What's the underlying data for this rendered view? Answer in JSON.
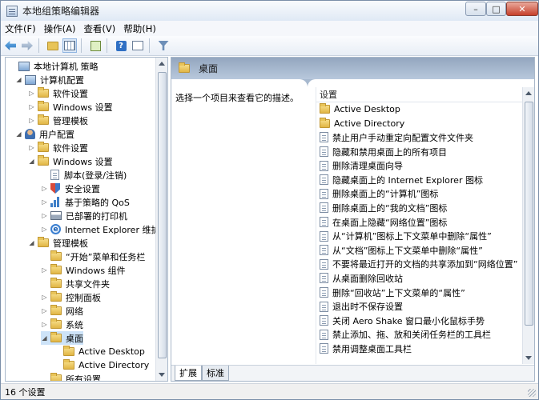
{
  "window": {
    "title": "本地组策略编辑器",
    "min": "–",
    "max": "□",
    "close": "✕"
  },
  "menu": [
    "文件(F)",
    "操作(A)",
    "查看(V)",
    "帮助(H)"
  ],
  "toolbar": {
    "icons": [
      "back-icon",
      "forward-icon",
      "up-folder-icon",
      "show-hide-tree-icon",
      "export-icon",
      "help-icon",
      "properties-icon",
      "filter-icon"
    ]
  },
  "tree": [
    {
      "label": "本地计算机 策略",
      "icon": "policy-icon",
      "level": 0,
      "exp": ""
    },
    {
      "label": "计算机配置",
      "icon": "computer-icon",
      "level": 1,
      "exp": "◢"
    },
    {
      "label": "软件设置",
      "icon": "folder-icon",
      "level": 2,
      "exp": "▷"
    },
    {
      "label": "Windows 设置",
      "icon": "folder-icon",
      "level": 2,
      "exp": "▷"
    },
    {
      "label": "管理模板",
      "icon": "folder-icon",
      "level": 2,
      "exp": "▷"
    },
    {
      "label": "用户配置",
      "icon": "user-icon",
      "level": 1,
      "exp": "◢"
    },
    {
      "label": "软件设置",
      "icon": "folder-icon",
      "level": 2,
      "exp": "▷"
    },
    {
      "label": "Windows 设置",
      "icon": "folder-icon",
      "level": 2,
      "exp": "◢"
    },
    {
      "label": "脚本(登录/注销)",
      "icon": "script-icon",
      "level": 3,
      "exp": ""
    },
    {
      "label": "安全设置",
      "icon": "security-icon",
      "level": 3,
      "exp": "▷"
    },
    {
      "label": "基于策略的 QoS",
      "icon": "qos-icon",
      "level": 3,
      "exp": "▷"
    },
    {
      "label": "已部署的打印机",
      "icon": "printer-icon",
      "level": 3,
      "exp": "▷"
    },
    {
      "label": "Internet Explorer 维护",
      "icon": "ie-icon",
      "level": 3,
      "exp": "▷"
    },
    {
      "label": "管理模板",
      "icon": "folder-icon",
      "level": 2,
      "exp": "◢"
    },
    {
      "label": "“开始”菜单和任务栏",
      "icon": "folder-icon",
      "level": 3,
      "exp": ""
    },
    {
      "label": "Windows 组件",
      "icon": "folder-icon",
      "level": 3,
      "exp": "▷"
    },
    {
      "label": "共享文件夹",
      "icon": "folder-icon",
      "level": 3,
      "exp": ""
    },
    {
      "label": "控制面板",
      "icon": "folder-icon",
      "level": 3,
      "exp": "▷"
    },
    {
      "label": "网络",
      "icon": "folder-icon",
      "level": 3,
      "exp": "▷"
    },
    {
      "label": "系统",
      "icon": "folder-icon",
      "level": 3,
      "exp": "▷"
    },
    {
      "label": "桌面",
      "icon": "folder-open-icon",
      "level": 3,
      "exp": "◢",
      "selected": true
    },
    {
      "label": "Active Desktop",
      "icon": "folder-icon",
      "level": 4,
      "exp": ""
    },
    {
      "label": "Active Directory",
      "icon": "folder-icon",
      "level": 4,
      "exp": ""
    },
    {
      "label": "所有设置",
      "icon": "folder-icon",
      "level": 3,
      "exp": ""
    }
  ],
  "content": {
    "header": "桌面",
    "description": "选择一个项目来查看它的描述。",
    "column": "设置",
    "items": [
      {
        "label": "Active Desktop",
        "icon": "folder-icon"
      },
      {
        "label": "Active Directory",
        "icon": "folder-icon"
      },
      {
        "label": "禁止用户手动重定向配置文件文件夹",
        "icon": "setting-icon"
      },
      {
        "label": "隐藏和禁用桌面上的所有项目",
        "icon": "setting-icon"
      },
      {
        "label": "删除清理桌面向导",
        "icon": "setting-icon"
      },
      {
        "label": "隐藏桌面上的 Internet Explorer 图标",
        "icon": "setting-icon"
      },
      {
        "label": "删除桌面上的“计算机”图标",
        "icon": "setting-icon"
      },
      {
        "label": "删除桌面上的“我的文档”图标",
        "icon": "setting-icon"
      },
      {
        "label": "在桌面上隐藏“网络位置”图标",
        "icon": "setting-icon"
      },
      {
        "label": "从“计算机”图标上下文菜单中删除“属性”",
        "icon": "setting-icon"
      },
      {
        "label": "从“文档”图标上下文菜单中删除“属性”",
        "icon": "setting-icon"
      },
      {
        "label": "不要将最近打开的文档的共享添加到“网络位置”",
        "icon": "setting-icon"
      },
      {
        "label": "从桌面删除回收站",
        "icon": "setting-icon"
      },
      {
        "label": "删除“回收站”上下文菜单的“属性”",
        "icon": "setting-icon"
      },
      {
        "label": "退出时不保存设置",
        "icon": "setting-icon"
      },
      {
        "label": "关闭 Aero Shake 窗口最小化鼠标手势",
        "icon": "setting-icon"
      },
      {
        "label": "禁止添加、拖、放和关闭任务栏的工具栏",
        "icon": "setting-icon"
      },
      {
        "label": "禁用调整桌面工具栏",
        "icon": "setting-icon"
      }
    ],
    "tabs": [
      "扩展",
      "标准"
    ]
  },
  "status": "16 个设置"
}
